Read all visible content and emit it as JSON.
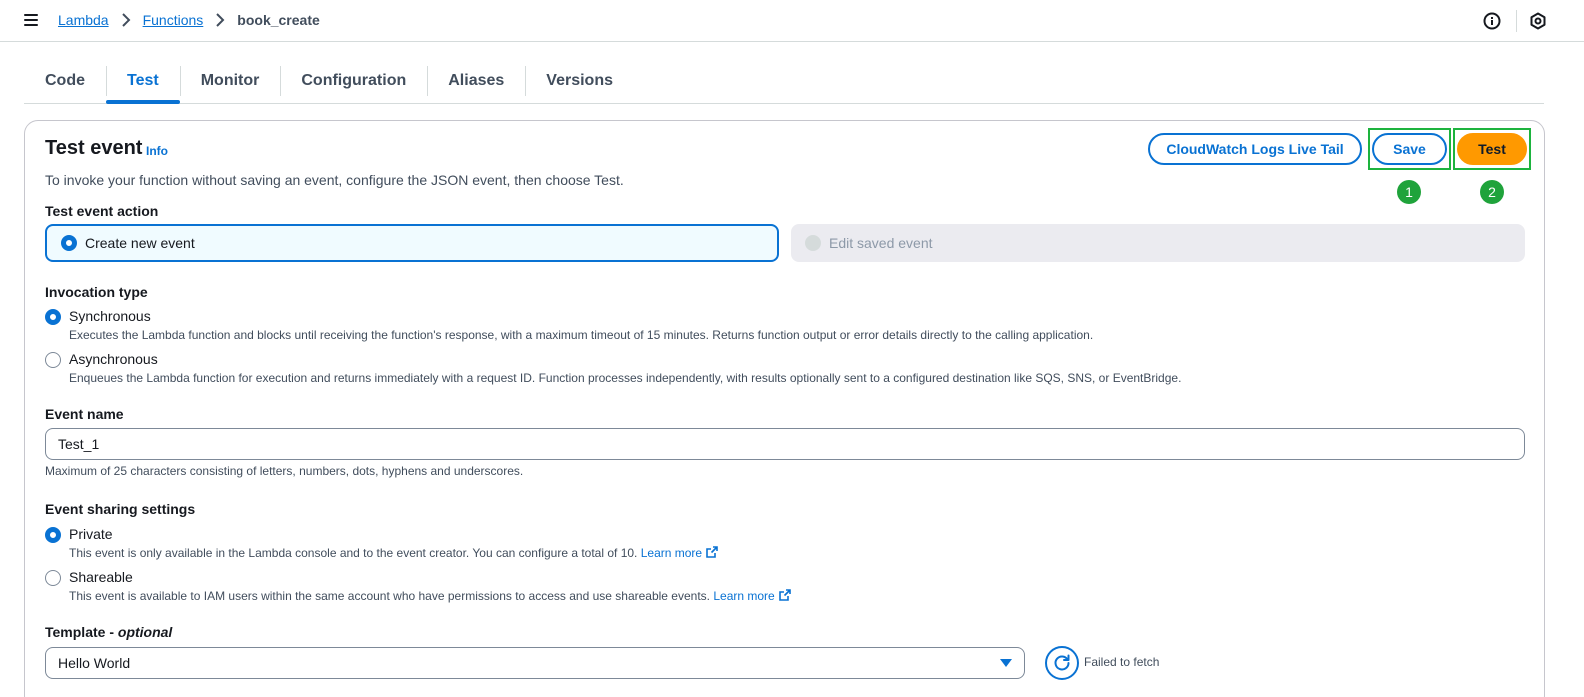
{
  "breadcrumb": {
    "items": [
      "Lambda",
      "Functions"
    ],
    "current": "book_create"
  },
  "header_icons": [
    "info-circle-icon",
    "settings-hexagon-icon"
  ],
  "tabs": [
    {
      "label": "Code",
      "active": false
    },
    {
      "label": "Test",
      "active": true
    },
    {
      "label": "Monitor",
      "active": false
    },
    {
      "label": "Configuration",
      "active": false
    },
    {
      "label": "Aliases",
      "active": false
    },
    {
      "label": "Versions",
      "active": false
    }
  ],
  "panel": {
    "title": "Test event",
    "info": "Info",
    "description": "To invoke your function without saving an event, configure the JSON event, then choose Test.",
    "buttons": {
      "live_tail": "CloudWatch Logs Live Tail",
      "save": "Save",
      "test": "Test"
    },
    "badges": [
      "1",
      "2"
    ],
    "highlight_color": "#1db33e"
  },
  "test_event_action": {
    "label": "Test event action",
    "options": [
      "Create new event",
      "Edit saved event"
    ],
    "selected": "Create new event"
  },
  "invocation_type": {
    "label": "Invocation type",
    "options": [
      {
        "label": "Synchronous",
        "desc": "Executes the Lambda function and blocks until receiving the function's response, with a maximum timeout of 15 minutes. Returns function output or error details directly to the calling application.",
        "selected": true
      },
      {
        "label": "Asynchronous",
        "desc": "Enqueues the Lambda function for execution and returns immediately with a request ID. Function processes independently, with results optionally sent to a configured destination like SQS, SNS, or EventBridge.",
        "selected": false
      }
    ]
  },
  "event_name": {
    "label": "Event name",
    "value": "Test_1",
    "hint": "Maximum of 25 characters consisting of letters, numbers, dots, hyphens and underscores."
  },
  "event_sharing": {
    "label": "Event sharing settings",
    "options": [
      {
        "label": "Private",
        "desc": "This event is only available in the Lambda console and to the event creator. You can configure a total of 10.",
        "link": "Learn more",
        "selected": true
      },
      {
        "label": "Shareable",
        "desc": "This event is available to IAM users within the same account who have permissions to access and use shareable events.",
        "link": "Learn more",
        "selected": false
      }
    ]
  },
  "template": {
    "label": "Template",
    "optional": "optional",
    "value": "Hello World",
    "status": "Failed to fetch"
  },
  "colors": {
    "link": "#0972d3",
    "primary_button": "#ff9900",
    "badge": "#1fa33b"
  }
}
